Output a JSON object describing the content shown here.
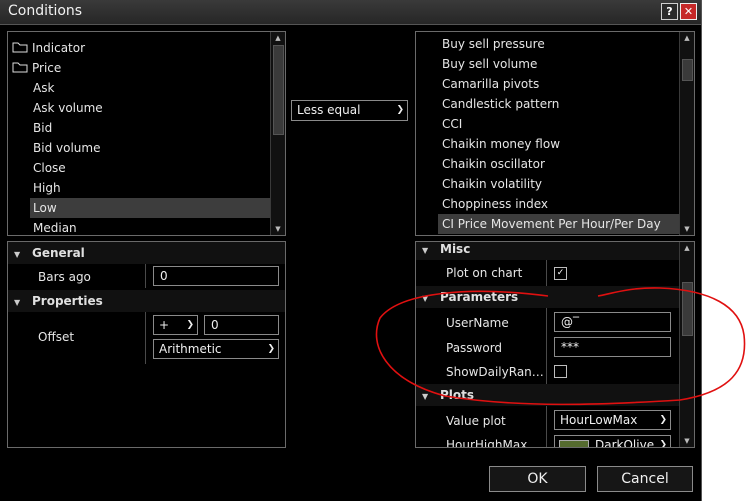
{
  "window": {
    "title": "Conditions"
  },
  "left_tree": {
    "items": [
      {
        "label": "Indicator",
        "folder": true
      },
      {
        "label": "Price",
        "folder": true,
        "open": true
      },
      {
        "label": "Ask"
      },
      {
        "label": "Ask volume"
      },
      {
        "label": "Bid"
      },
      {
        "label": "Bid volume"
      },
      {
        "label": "Close"
      },
      {
        "label": "High"
      },
      {
        "label": "Low",
        "selected": true
      },
      {
        "label": "Median"
      }
    ]
  },
  "operator": {
    "value": "Less equal"
  },
  "right_list": {
    "items": [
      "Buy sell pressure",
      "Buy sell volume",
      "Camarilla pivots",
      "Candlestick pattern",
      "CCI",
      "Chaikin money flow",
      "Chaikin oscillator",
      "Chaikin volatility",
      "Choppiness index",
      "CI Price Movement Per Hour/Per Day"
    ],
    "selected_index": 9
  },
  "left_props": {
    "general_label": "General",
    "bars_ago_label": "Bars ago",
    "bars_ago_value": "0",
    "properties_label": "Properties",
    "offset_label": "Offset",
    "offset_sign": "+",
    "offset_value": "0",
    "offset_type": "Arithmetic"
  },
  "right_props": {
    "misc_label": "Misc",
    "plot_on_chart_label": "Plot on chart",
    "plot_on_chart_checked": true,
    "parameters_label": "Parameters",
    "username_label": "UserName",
    "username_value": "@‾",
    "password_label": "Password",
    "password_value": "***",
    "show_daily_label": "ShowDailyRan…",
    "show_daily_checked": false,
    "plots_label": "Plots",
    "value_plot_label": "Value plot",
    "value_plot_value": "HourLowMax",
    "hour_high_label": "HourHighMax",
    "hour_high_value": "DarkOlive…",
    "hour_high_color": "#556b2f"
  },
  "buttons": {
    "ok": "OK",
    "cancel": "Cancel"
  },
  "annotation": {
    "color": "#e01010"
  }
}
